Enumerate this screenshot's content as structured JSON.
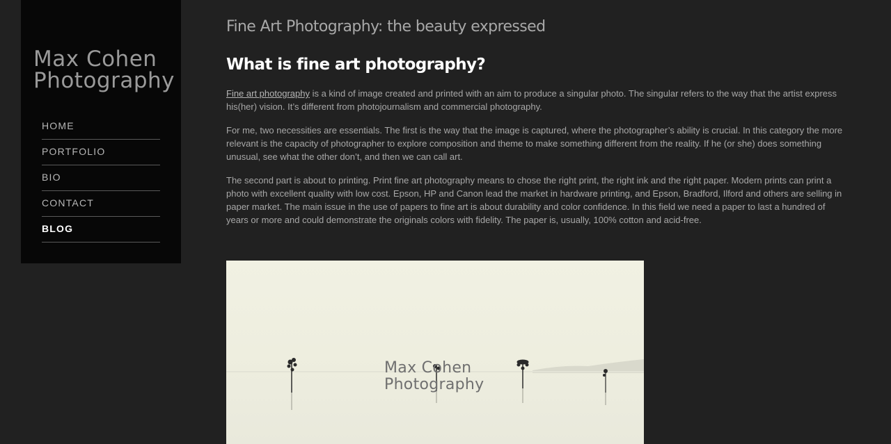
{
  "sidebar": {
    "logo_line1": "Max Cohen",
    "logo_line2": "Photography",
    "nav": [
      {
        "label": "HOME"
      },
      {
        "label": "PORTFOLIO"
      },
      {
        "label": "BIO"
      },
      {
        "label": "CONTACT"
      },
      {
        "label": "BLOG",
        "active": true
      }
    ]
  },
  "main": {
    "page_title": "Fine Art Photography: the beauty expressed",
    "section_heading": "What is fine art photography?",
    "paragraph1_link": "Fine art photography",
    "paragraph1_rest": " is a kind of image created and printed with an aim to produce a singular photo. The singular refers to the way that the artist express his(her) vision. It’s different from photojournalism and commercial photography.",
    "paragraph2": "For me, two necessities are essentials. The first is the way that the image is captured, where the photographer’s ability is crucial. In this category the more relevant is the capacity of photographer to explore composition and theme to make something different from the reality. If he (or she) does something unusual, see what the other don’t, and then we can call art.",
    "paragraph3": "The second part is about to printing. Print fine art photography means to chose the right print, the right ink and the right paper. Modern prints can print a photo with excellent quality with low cost. Epson, HP and Canon lead the market in hardware printing, and Epson, Bradford, Ilford and others are selling in paper market. The main issue in the use of papers to fine art is about durability and color confidence. In this field we need a paper to last a hundred of years or more and could demonstrate the originals colors with fidelity. The paper is, usually, 100% cotton and acid-free.",
    "photo": {
      "watermark_line1": "Max Cohen",
      "watermark_line2": "Photography"
    }
  }
}
